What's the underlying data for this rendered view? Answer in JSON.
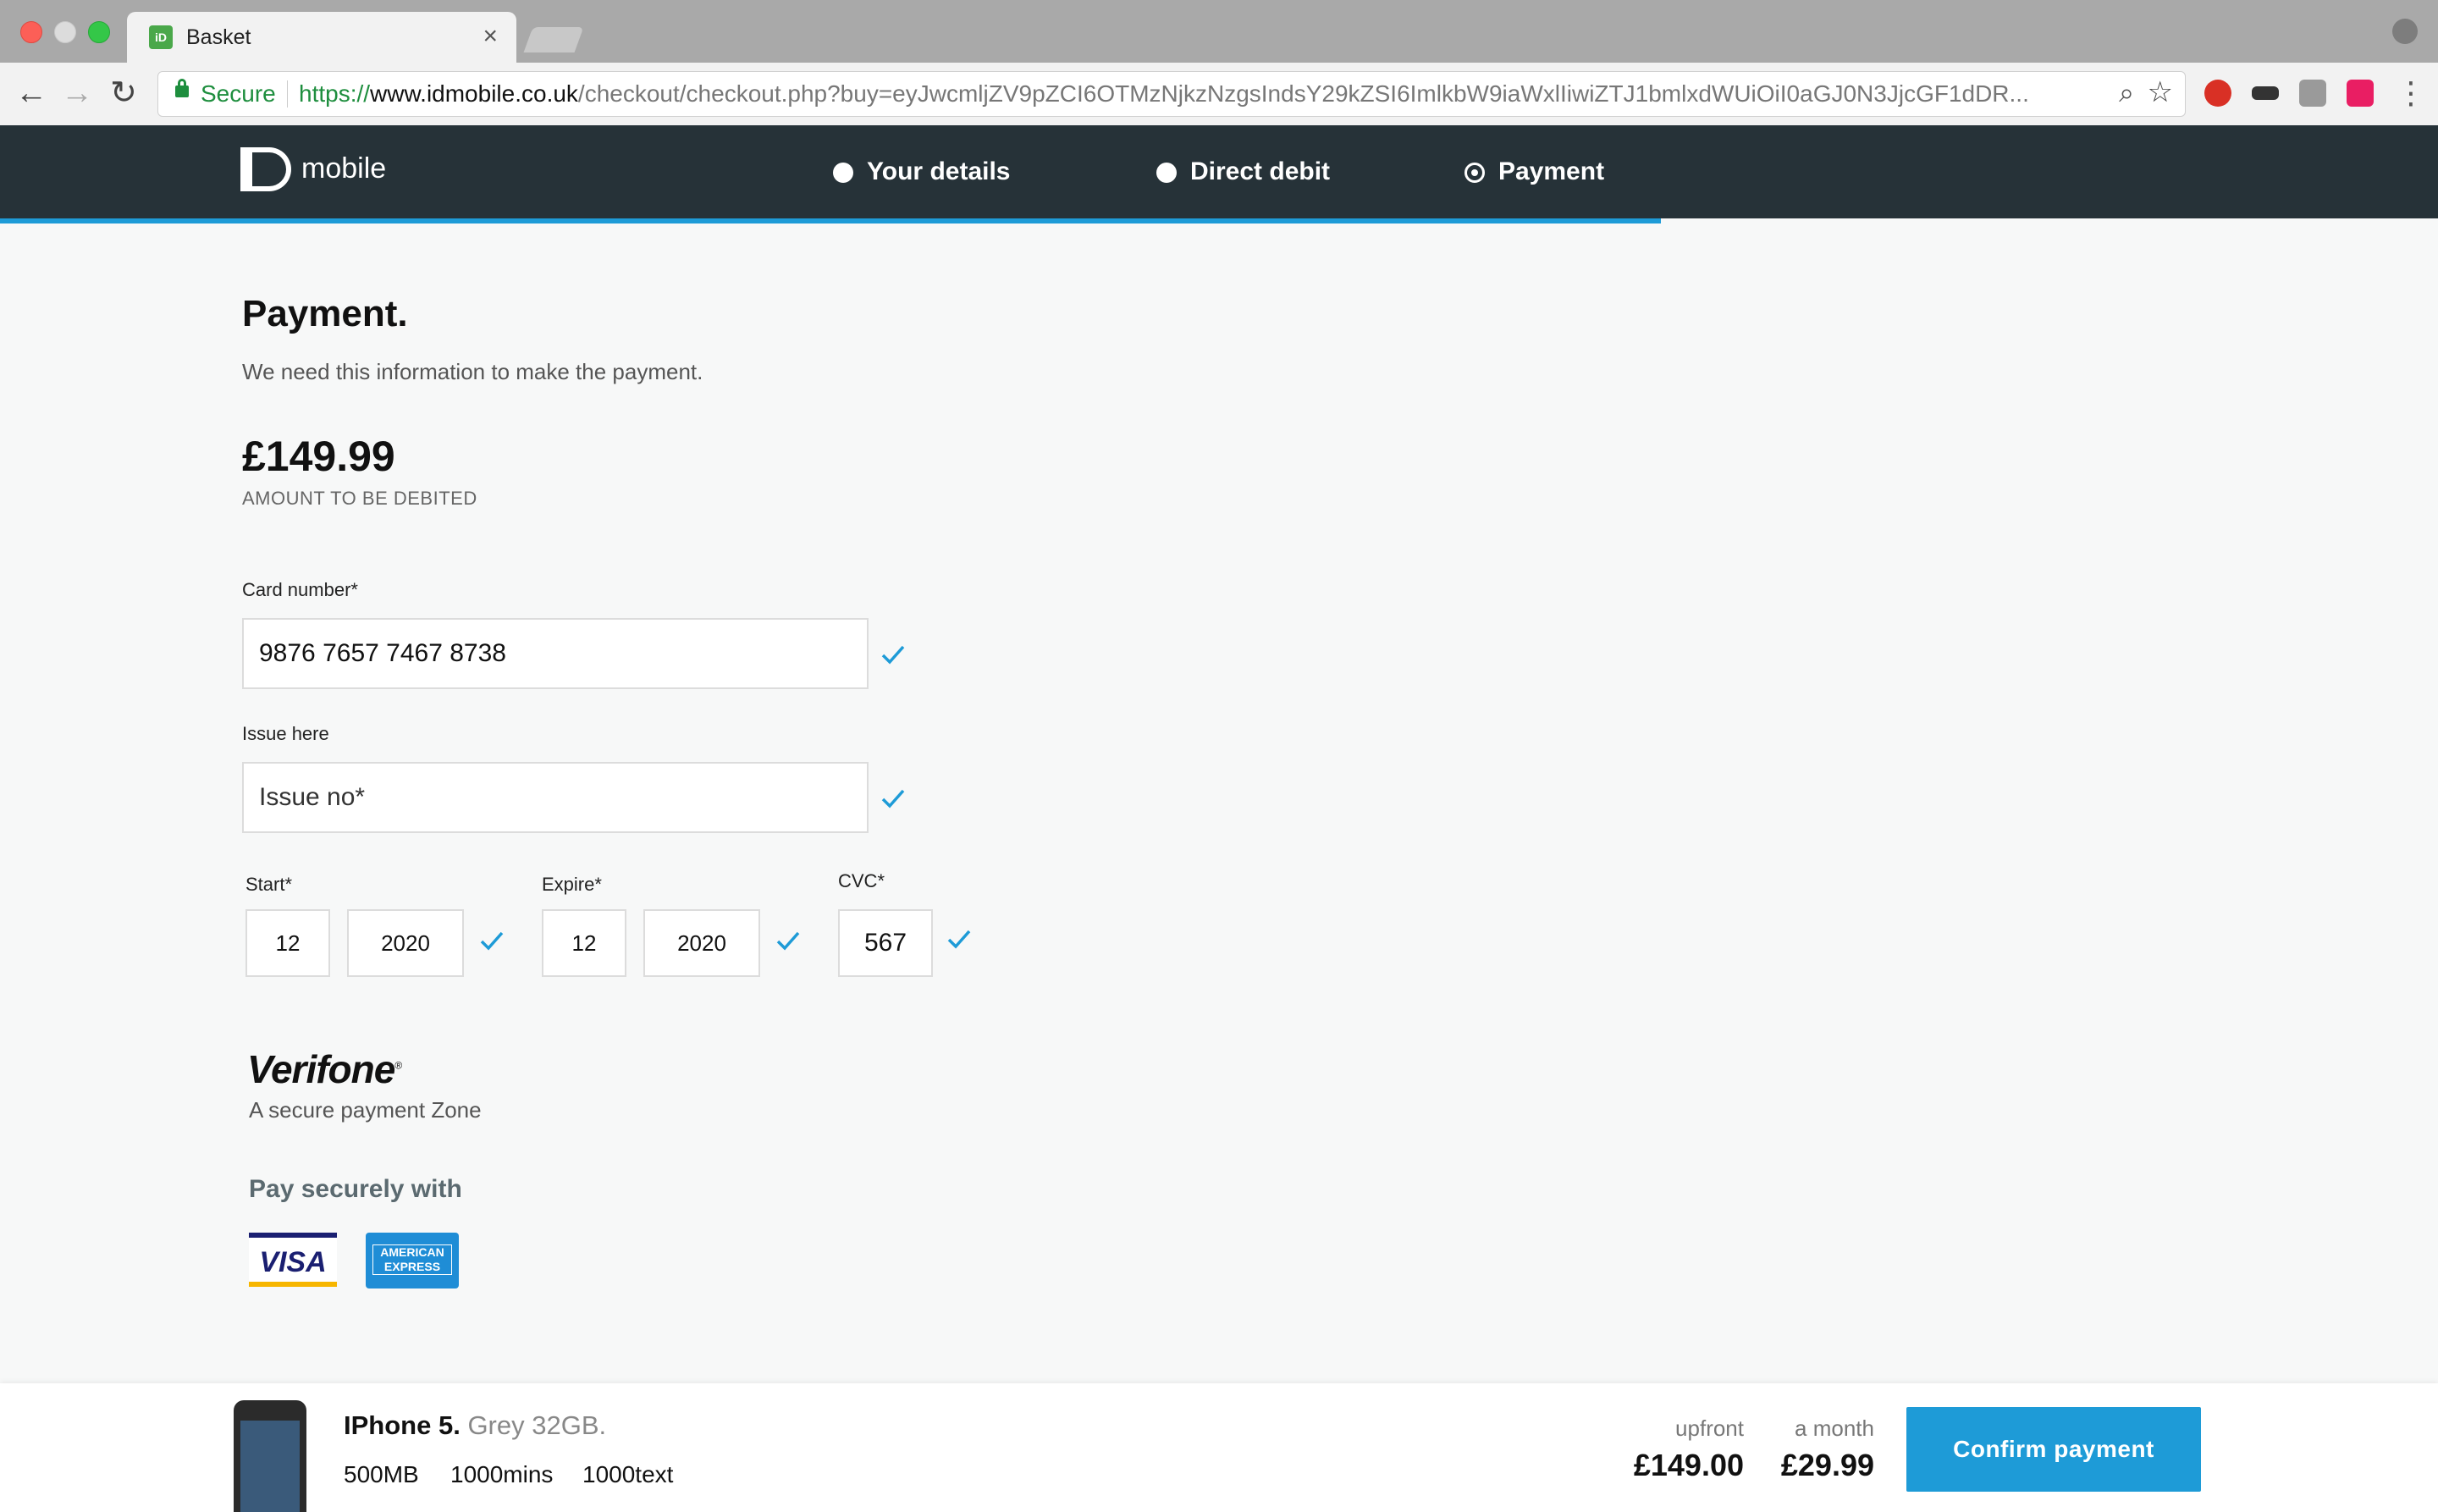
{
  "browser": {
    "tab_title": "Basket",
    "tab_close": "×",
    "secure_label": "Secure",
    "url_scheme": "https://",
    "url_host": "www.idmobile.co.uk",
    "url_rest": "/checkout/checkout.php?buy=eyJwcmljZV9pZCI6OTMzNjkzNzgsIndsY29kZSI6ImlkbW9iaWxlIiwiZTJ1bmlxdWUiOiI0aGJ0N3JjcGF1dDR..."
  },
  "header": {
    "logo_text": "mobile",
    "steps": [
      {
        "label": "Your details"
      },
      {
        "label": "Direct debit"
      },
      {
        "label": "Payment"
      }
    ]
  },
  "main": {
    "title": "Payment.",
    "subtitle": "We need this information to make the payment.",
    "amount": "£149.99",
    "amount_caption": "AMOUNT TO BE DEBITED",
    "card_number": {
      "label": "Card number*",
      "value": "9876 7657 7467 8738"
    },
    "issue": {
      "label": "Issue here",
      "placeholder": "Issue no*"
    },
    "start": {
      "label": "Start*",
      "month": "12",
      "year": "2020"
    },
    "expire": {
      "label": "Expire*",
      "month": "12",
      "year": "2020"
    },
    "cvc": {
      "label": "CVC*",
      "value": "567"
    },
    "verifone": {
      "logo": "Verifone",
      "tagline": "A secure payment Zone"
    },
    "pay_securely": "Pay securely with",
    "cards": {
      "visa": "VISA",
      "amex": "AMERICAN EXPRESS"
    }
  },
  "footer": {
    "product_name": "IPhone 5.",
    "product_variant": "Grey 32GB.",
    "specs": [
      "500MB",
      "1000mins",
      "1000text"
    ],
    "upfront_label": "upfront",
    "upfront_value": "£149.00",
    "month_label": "a month",
    "month_value": "£29.99",
    "confirm_label": "Confirm payment"
  },
  "colors": {
    "header_bg": "#263238",
    "accent": "#1e9bd7",
    "check": "#1e9bd7"
  }
}
